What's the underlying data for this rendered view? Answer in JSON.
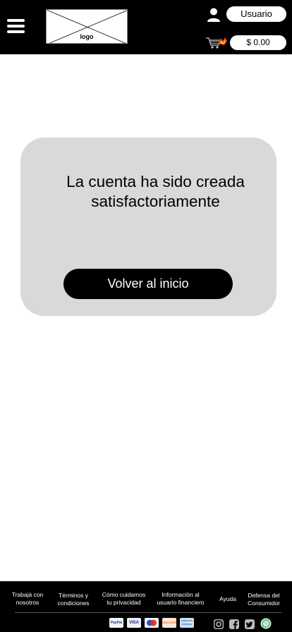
{
  "header": {
    "logo_text": "logo",
    "user_label": "Usuario",
    "balance": "$ 0.00"
  },
  "card": {
    "message": "La cuenta ha sido creada satisfactoriamente",
    "button_label": "Volver al inicio"
  },
  "footer": {
    "links": [
      "Trabajá con\nnosotros",
      "Términos y\ncondiciones",
      "Cómo cuidamos\ntu privacidad",
      "Información al\nusuario financiero",
      "Ayuda",
      "Defensa del\nConsumidor"
    ],
    "payment_methods": [
      "PayPal",
      "VISA",
      "Maestro",
      "DISCOVER",
      "AMERICAN EXPRESS"
    ],
    "social_icons": [
      "instagram-icon",
      "facebook-icon",
      "twitter-icon",
      "whatsapp-icon"
    ]
  },
  "colors": {
    "header_bg": "#000000",
    "card_bg": "#d9d9db",
    "button_bg": "#000000",
    "footer_bg": "#000000"
  }
}
